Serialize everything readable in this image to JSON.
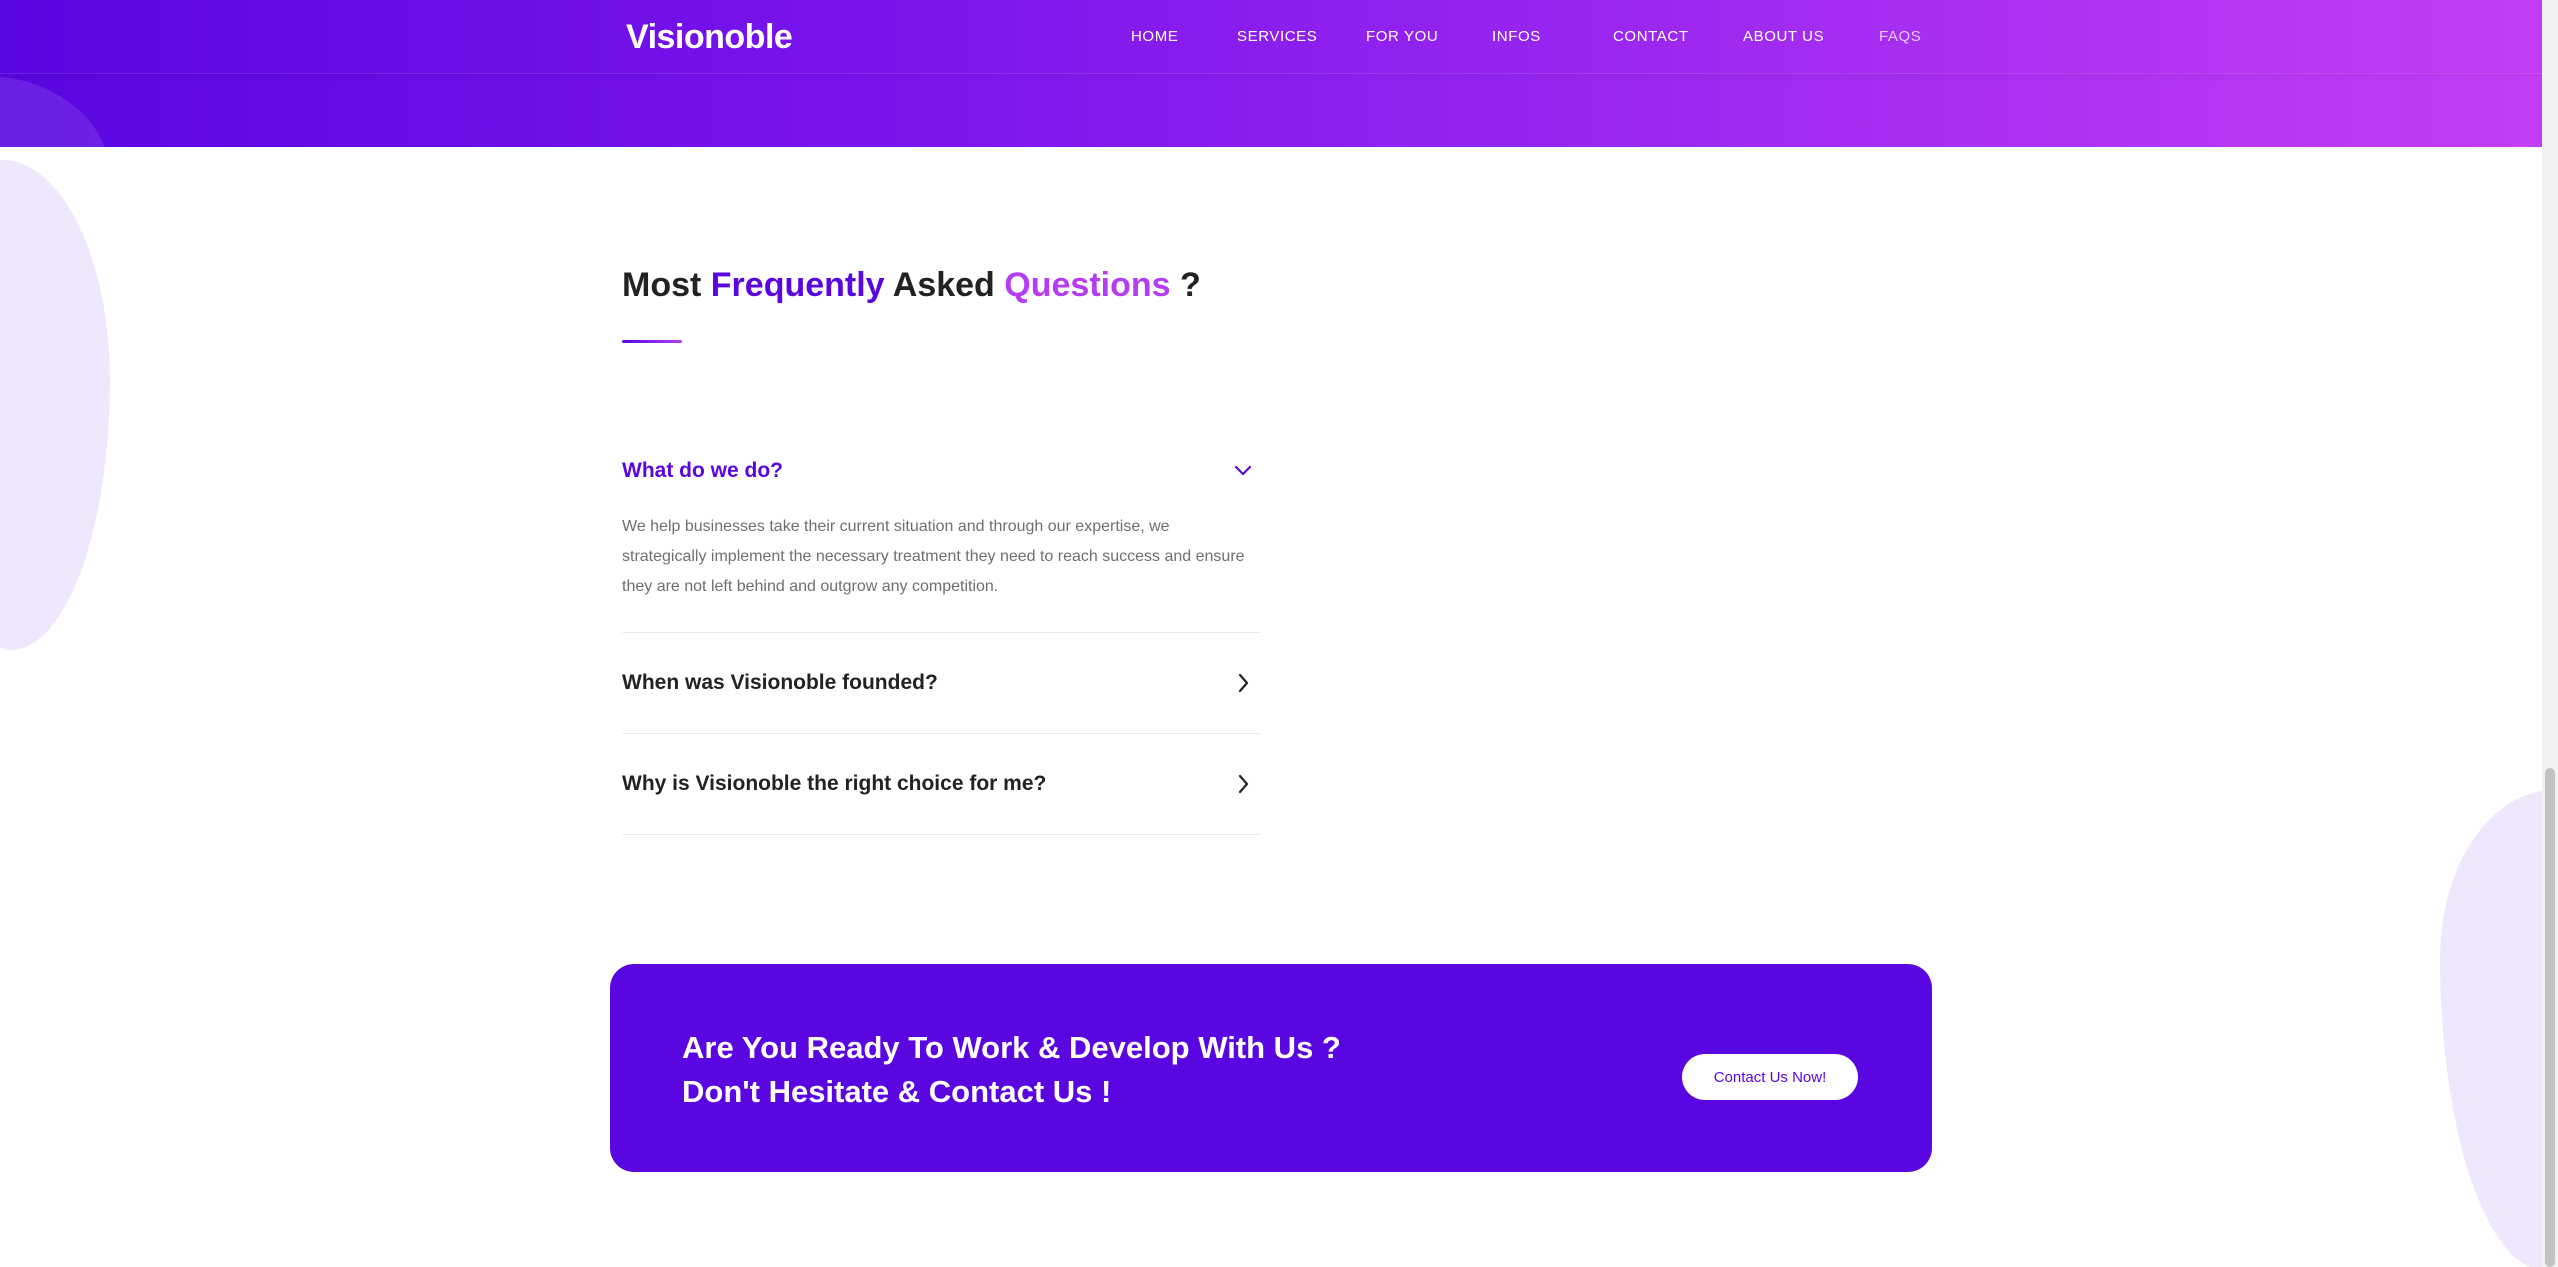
{
  "header": {
    "logo": "Visionoble",
    "nav": [
      "HOME",
      "SERVICES",
      "FOR YOU",
      "INFOS",
      "CONTACT",
      "ABOUT US",
      "FAQS"
    ]
  },
  "faq": {
    "title_part1": "Most ",
    "title_highlight1": "Frequently",
    "title_part2": " Asked ",
    "title_highlight2": "Questions",
    "title_part3": " ?",
    "items": [
      {
        "question": "What do we do?",
        "answer": "We help businesses take their current situation and through our expertise, we strategically implement the necessary treatment they need to reach success and ensure they are not left behind and outgrow any competition.",
        "icon": "chevron-down-icon"
      },
      {
        "question": "When was Visionoble founded?",
        "icon": "chevron-right-icon"
      },
      {
        "question": "Why is Visionoble the right choice for me?",
        "icon": "chevron-right-icon"
      }
    ]
  },
  "cta": {
    "line1": "Are You Ready To Work & Develop With Us ?",
    "line2": "Don't Hesitate & Contact Us !",
    "button": "Contact Us Now!"
  },
  "colors": {
    "primary": "#5a06e0",
    "accent": "#b53cf3",
    "gradient_end": "#c43df6"
  }
}
